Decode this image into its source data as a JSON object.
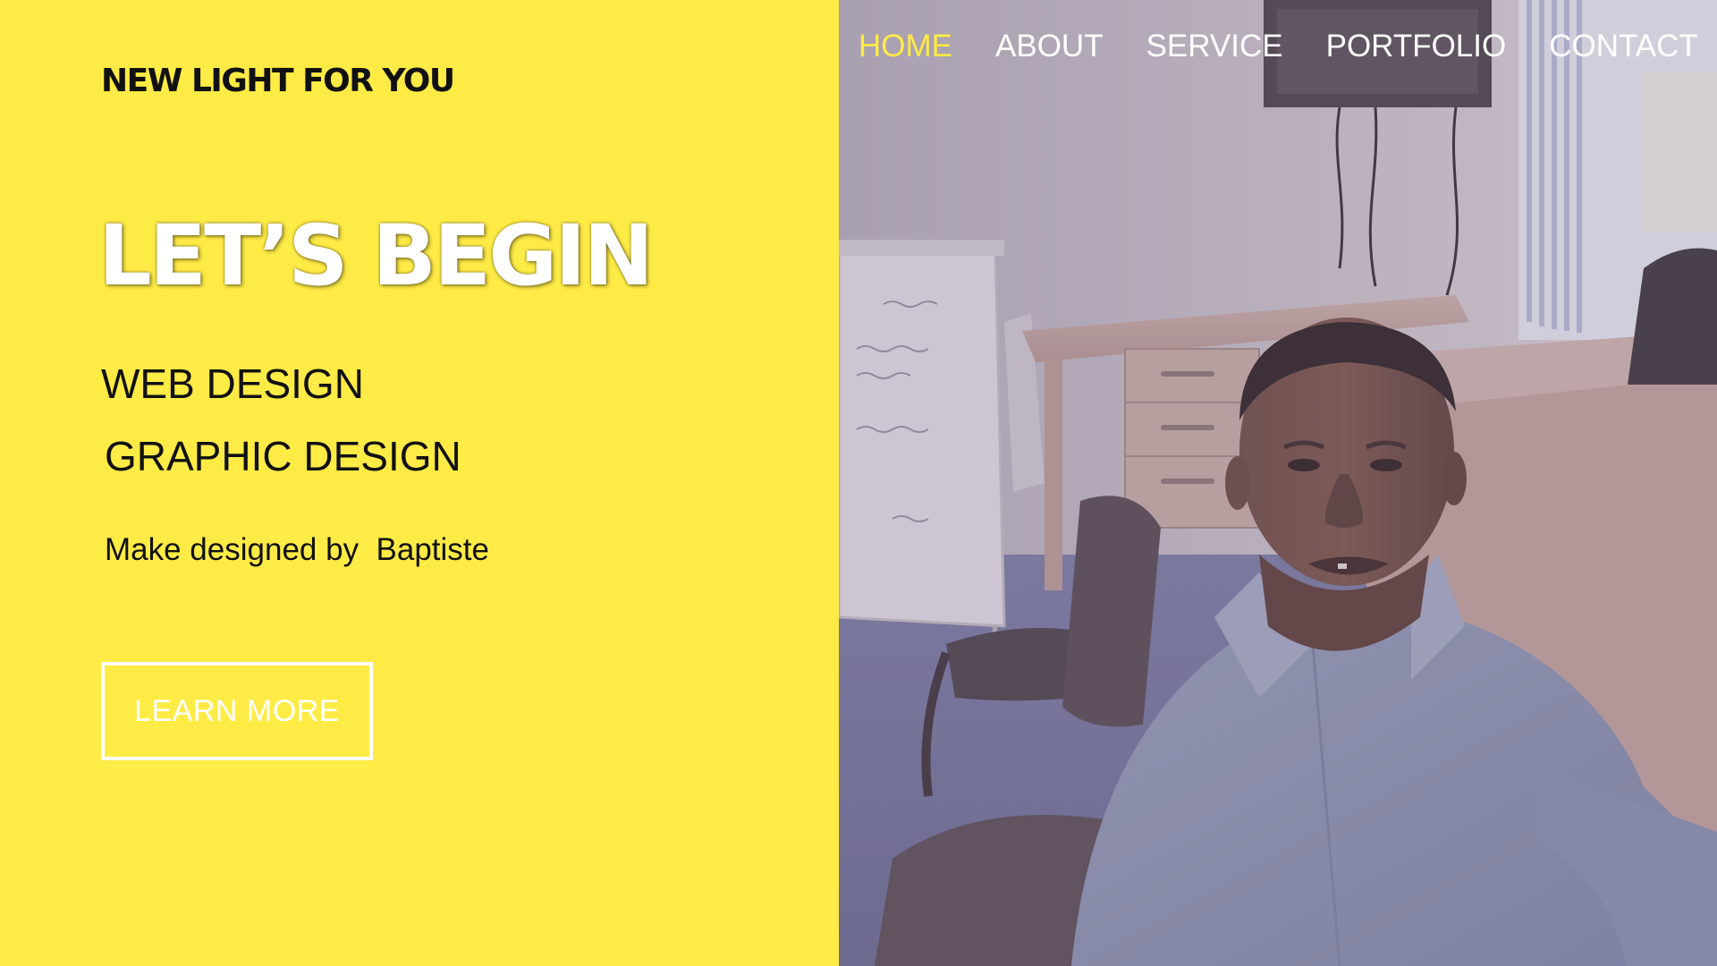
{
  "brand": {
    "name": "NEW LIGHT FOR YOU"
  },
  "hero": {
    "title": "LET’S BEGIN",
    "services": [
      "WEB DESIGN",
      "GRAPHIC DESIGN"
    ],
    "credit": "Make designed by  Baptiste",
    "cta_label": "LEARN MORE"
  },
  "nav": {
    "items": [
      {
        "label": "HOME",
        "active": true
      },
      {
        "label": "ABOUT",
        "active": false
      },
      {
        "label": "SERVICE",
        "active": false
      },
      {
        "label": "PORTFOLIO",
        "active": false
      },
      {
        "label": "CONTACT",
        "active": false
      }
    ]
  },
  "colors": {
    "accent": "#FFEB45",
    "text_dark": "#111111",
    "text_light": "#ffffff"
  }
}
